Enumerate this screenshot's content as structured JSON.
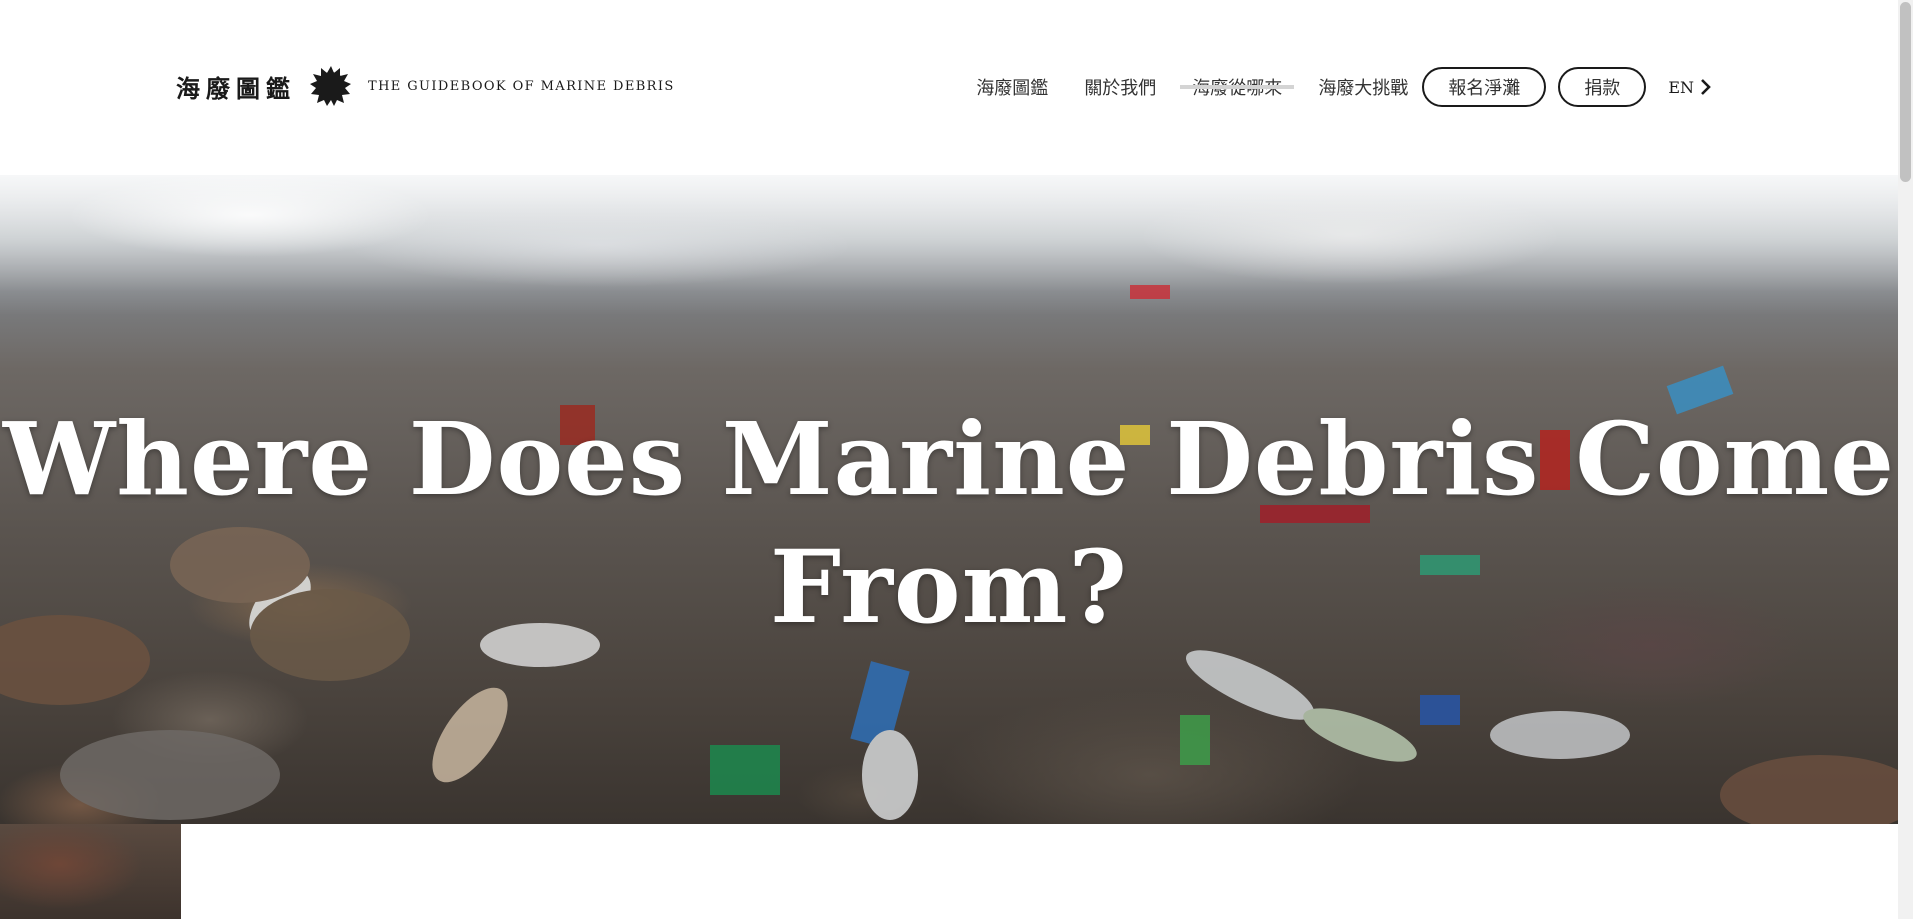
{
  "header": {
    "brand_zh": "海廢圖鑑",
    "brand_en": "THE GUIDEBOOK OF MARINE DEBRIS",
    "nav": [
      {
        "label": "海廢圖鑑"
      },
      {
        "label": "關於我們"
      },
      {
        "label": "海廢從哪來"
      },
      {
        "label": "海廢大挑戰"
      }
    ],
    "buttons": {
      "signup": "報名淨灘",
      "donate": "捐款"
    },
    "lang": "EN"
  },
  "hero": {
    "title": "Where Does Marine Debris Come From?"
  },
  "colors": {
    "text": "#222222",
    "brand": "#1a1a1a",
    "hero_text": "#ffffff"
  }
}
